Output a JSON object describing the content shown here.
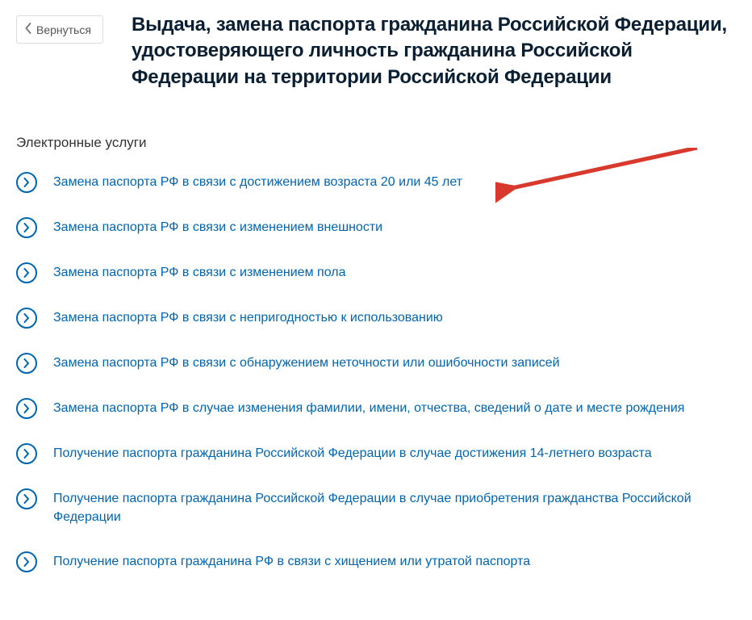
{
  "back_label": "Вернуться",
  "page_title": "Выдача, замена паспорта гражданина Российской Федерации, удостоверяющего личность гражданина Российской Федерации на территории Российской Федерации",
  "section_title": "Электронные услуги",
  "services": [
    {
      "label": "Замена паспорта РФ в связи с достижением возраста 20 или 45 лет"
    },
    {
      "label": "Замена паспорта РФ в связи с изменением внешности"
    },
    {
      "label": "Замена паспорта РФ в связи с изменением пола"
    },
    {
      "label": "Замена паспорта РФ в связи с непригодностью к использованию"
    },
    {
      "label": "Замена паспорта РФ в связи с обнаружением неточности или ошибочности записей"
    },
    {
      "label": "Замена паспорта РФ в случае изменения фамилии, имени, отчества, сведений о дате и месте рождения"
    },
    {
      "label": "Получение паспорта гражданина Российской Федерации в случае достижения 14-летнего возраста"
    },
    {
      "label": "Получение паспорта гражданина Российской Федерации в случае приобретения гражданства Российской Федерации"
    },
    {
      "label": "Получение паспорта гражданина РФ в связи с хищением или утратой паспорта"
    }
  ],
  "colors": {
    "link": "#0065b1",
    "title": "#0b1f33",
    "arrow": "#d9392d"
  }
}
